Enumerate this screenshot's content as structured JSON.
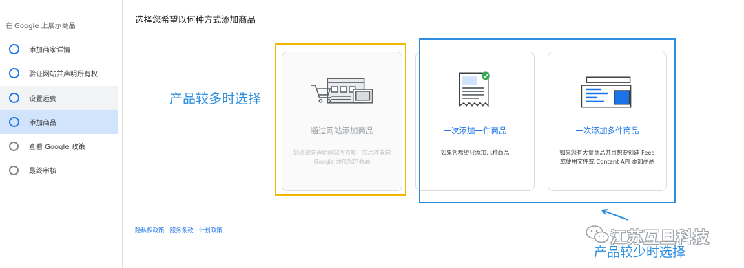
{
  "sidebar": {
    "title": "在 Google 上展示商品",
    "steps": [
      {
        "label": "添加商家详情"
      },
      {
        "label": "验证网站并声明所有权"
      },
      {
        "label": "设置运费"
      },
      {
        "label": "添加商品"
      },
      {
        "label": "查看 Google 政策"
      },
      {
        "label": "最终审核"
      }
    ]
  },
  "main": {
    "heading": "选择您希望以何种方式添加商品",
    "cards": [
      {
        "title": "通过网站添加商品",
        "description": "您必须先声明网站所有权，然后才能向 Google 添加您的商品",
        "icon": "cart-website-icon",
        "disabled": true
      },
      {
        "title": "一次添加一件商品",
        "description": "如果您希望只添加几种商品",
        "icon": "receipt-check-icon",
        "disabled": false
      },
      {
        "title": "一次添加多件商品",
        "description": "如果您有大量商品并且想要创建 Feed 或使用文件或 Content API 添加商品",
        "icon": "feed-screen-icon",
        "disabled": false
      }
    ]
  },
  "annotations": {
    "many_products": "产品较多时选择",
    "few_products": "产品较少时选择"
  },
  "footer": {
    "privacy": "隐私权政策",
    "sep1": " · ",
    "terms": "服务条款",
    "sep2": " · ",
    "program": "计划政策"
  },
  "watermark": {
    "text": "江苏互旦科技",
    "icon": "wechat-icon"
  },
  "colors": {
    "accent": "#1a73e8",
    "annotation_blue": "#2d8fe0",
    "annotation_yellow": "#f2b800",
    "active_step_bg": "#d2e3fc"
  }
}
